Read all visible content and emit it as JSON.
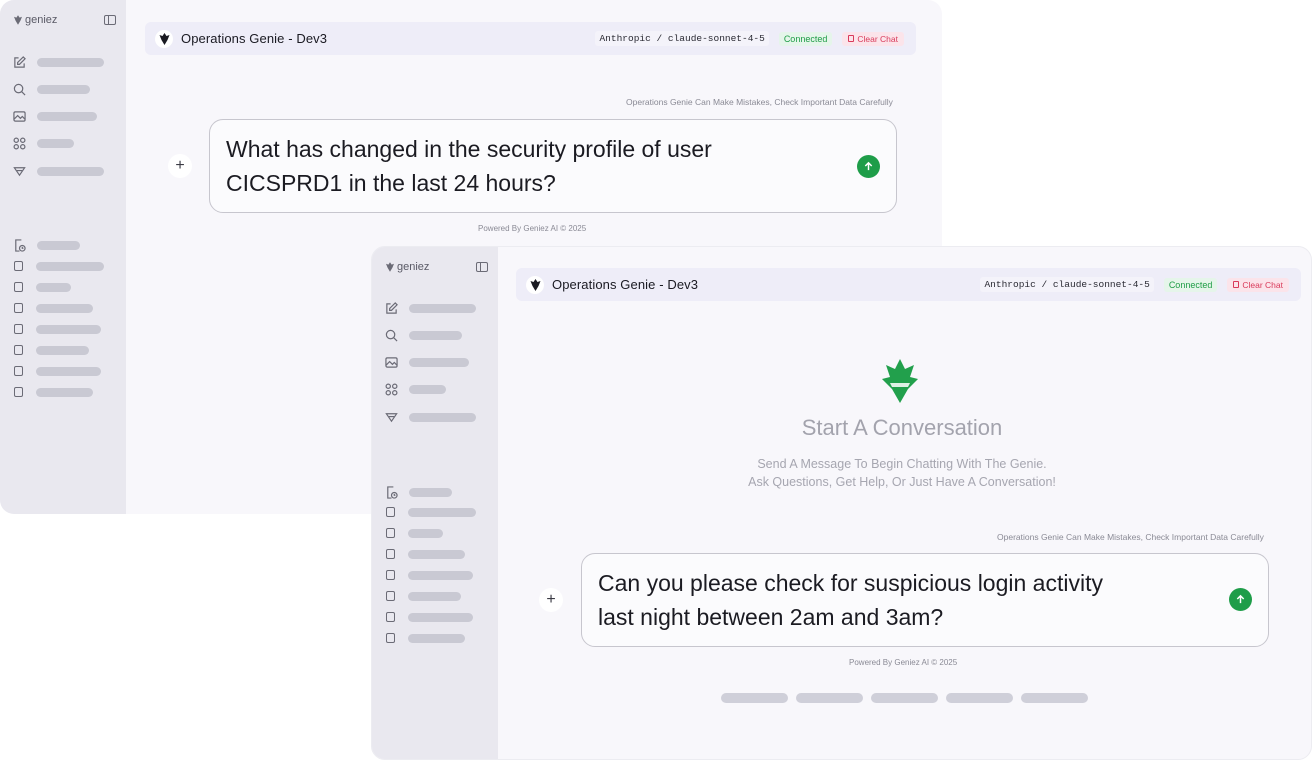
{
  "back_window": {
    "brand": "geniez",
    "header": {
      "title": "Operations Genie - Dev3",
      "model": "Anthropic / claude-sonnet-4-5",
      "status": "Connected",
      "clear_label": "Clear Chat"
    },
    "notice": "Operations Genie Can Make Mistakes, Check Important Data Carefully",
    "input_value": "What has changed in the security profile of user CICSPRD1 in the last 24 hours?",
    "footer": "Powered By Geniez AI © 2025"
  },
  "front_window": {
    "brand": "geniez",
    "header": {
      "title": "Operations Genie - Dev3",
      "model": "Anthropic / claude-sonnet-4-5",
      "status": "Connected",
      "clear_label": "Clear Chat"
    },
    "empty_state": {
      "title": "Start A Conversation",
      "subtitle_line1": "Send A Message To Begin Chatting With The Genie.",
      "subtitle_line2": "Ask Questions, Get Help, Or Just Have A Conversation!"
    },
    "notice": "Operations Genie Can Make Mistakes, Check Important Data Carefully",
    "input_value": "Can you please check for suspicious login activity last night between 2am and 3am?",
    "footer": "Powered By Geniez AI © 2025"
  },
  "icons": {
    "nav": [
      "new-chat-icon",
      "search-icon",
      "image-icon",
      "apps-grid-icon",
      "send-filter-icon"
    ],
    "history_header": "document-history-icon",
    "send": "arrow-up-icon",
    "add": "plus-icon"
  },
  "colors": {
    "accent_green": "#1e9d49",
    "connected_text": "#1f9d46",
    "clear_text": "#d93a5a",
    "sidebar_bg": "#e9e8ef",
    "header_bg": "#eeedf8"
  }
}
